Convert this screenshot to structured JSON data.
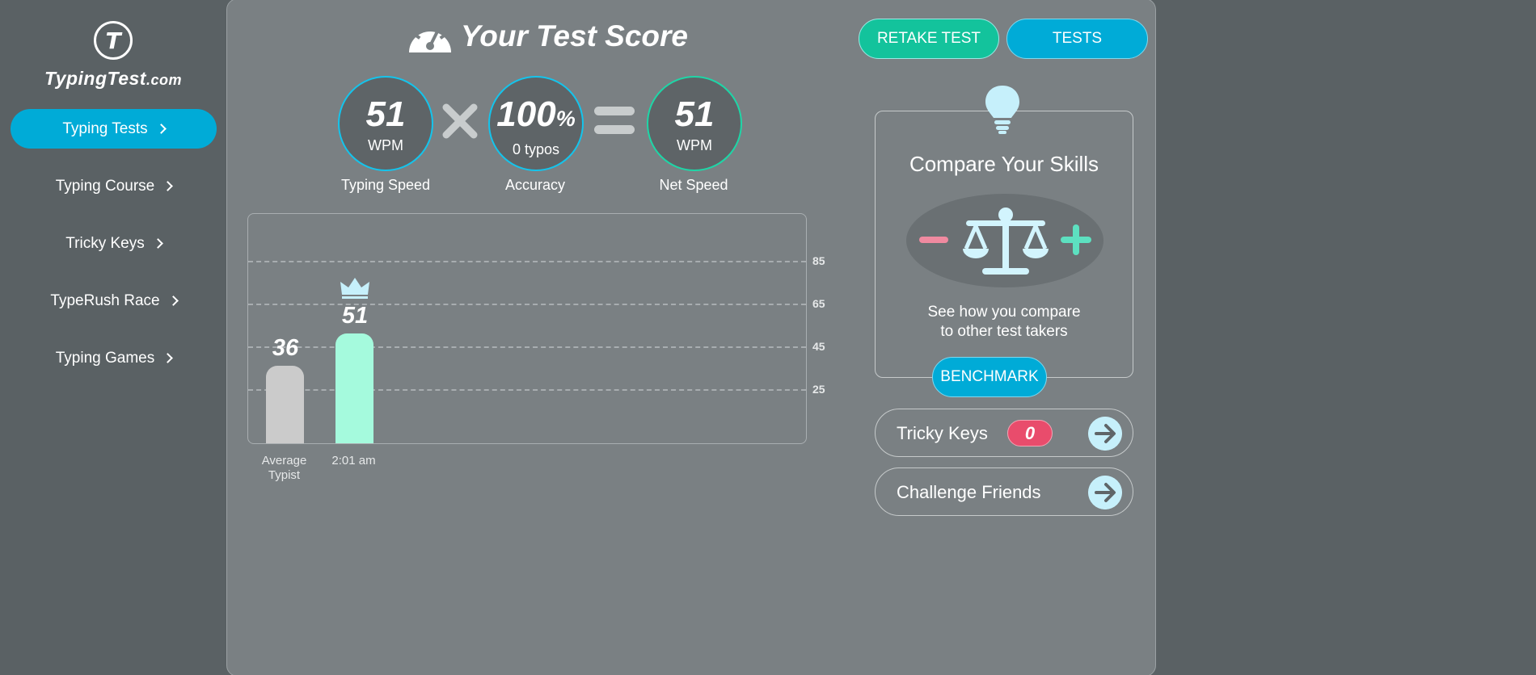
{
  "brand": {
    "name": "TypingTest",
    "domain": ".com"
  },
  "sidebar": {
    "items": [
      {
        "label": "Typing Tests",
        "active": true
      },
      {
        "label": "Typing Course",
        "active": false
      },
      {
        "label": "Tricky Keys",
        "active": false
      },
      {
        "label": "TypeRush Race",
        "active": false
      },
      {
        "label": "Typing Games",
        "active": false
      }
    ]
  },
  "header": {
    "title": "Your Test Score",
    "retake_label": "RETAKE TEST",
    "tests_label": "TESTS"
  },
  "scores": {
    "speed": {
      "value": "51",
      "unit": "WPM",
      "label": "Typing Speed"
    },
    "accuracy": {
      "value": "100",
      "pct": "%",
      "typos": "0  typos",
      "label": "Accuracy"
    },
    "net": {
      "value": "51",
      "unit": "WPM",
      "label": "Net Speed"
    }
  },
  "chart_data": {
    "type": "bar",
    "categories": [
      "Average\nTypist",
      "2:01 am"
    ],
    "values": [
      36,
      51
    ],
    "value_labels": [
      "36",
      "51"
    ],
    "ticks": [
      85,
      65,
      45,
      25
    ],
    "grid": true,
    "highlight": "2:01 am",
    "colors": {
      "avg": "#cbcbcb",
      "you": "#a5fadd"
    }
  },
  "compare": {
    "title": "Compare Your Skills",
    "text_line1": "See how you compare",
    "text_line2": "to other test takers",
    "benchmark_label": "BENCHMARK"
  },
  "tricky": {
    "label": "Tricky Keys",
    "count": "0"
  },
  "challenge": {
    "label": "Challenge Friends"
  },
  "colors": {
    "accent_blue": "#00abd7",
    "accent_green": "#13c39c",
    "panel": "#7a8083",
    "background": "#5a6164",
    "badge_red": "#e94c6c"
  }
}
